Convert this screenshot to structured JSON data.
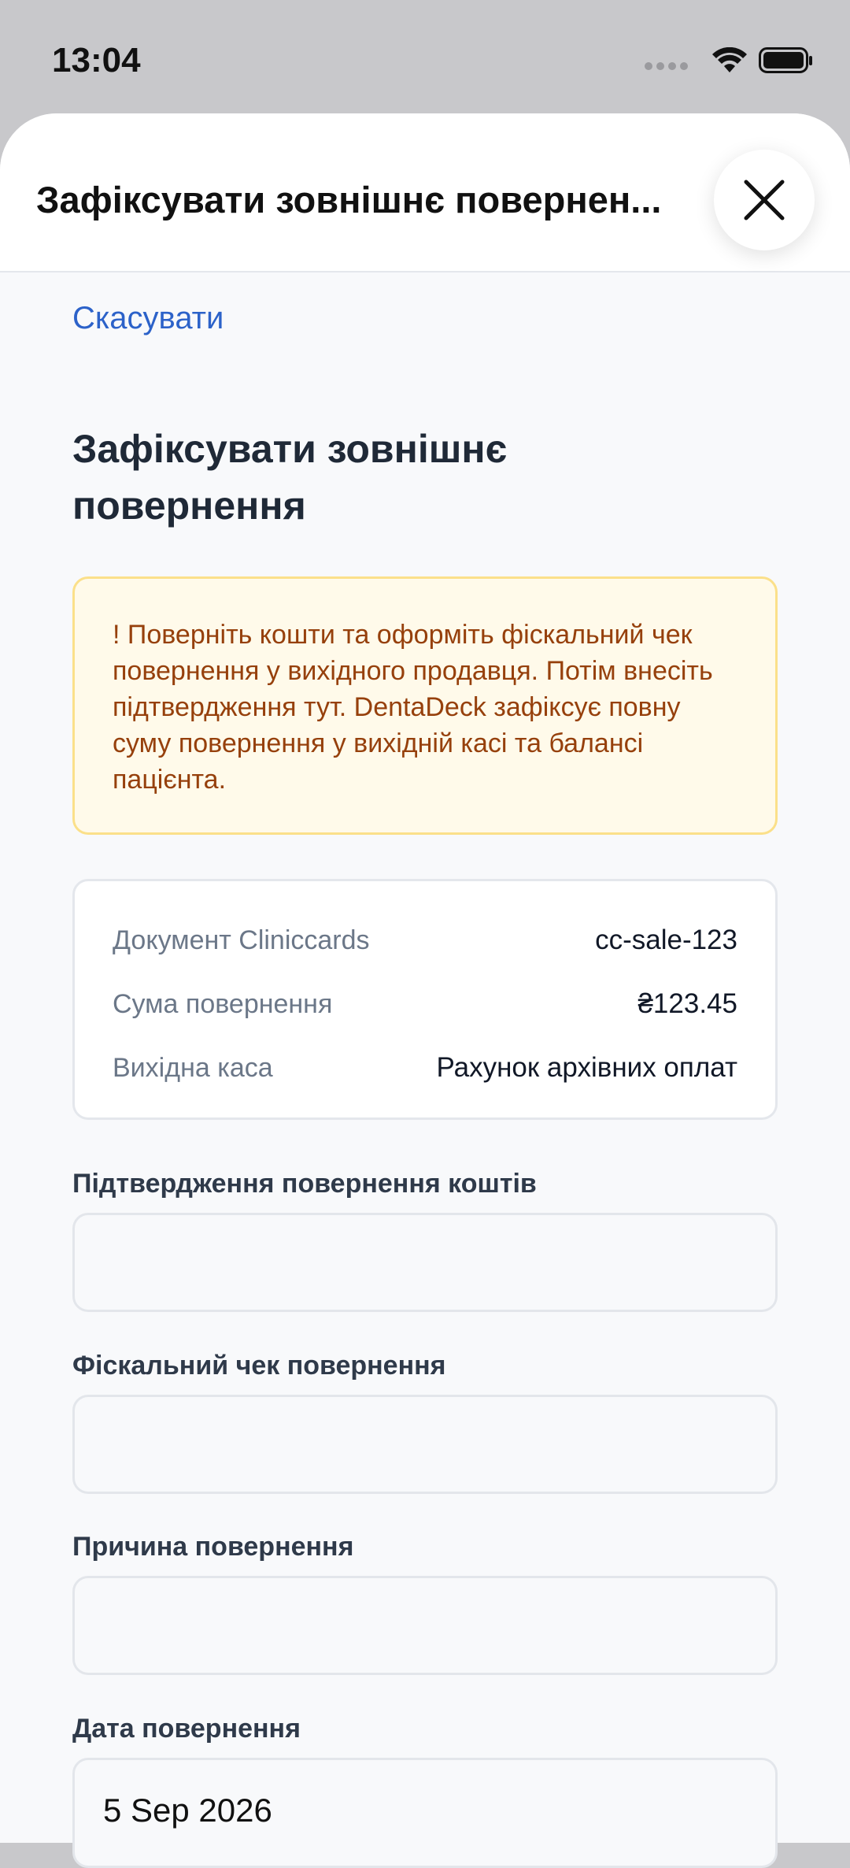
{
  "status_bar": {
    "time": "13:04"
  },
  "sheet": {
    "title": "Зафіксувати зовнішнє повернен..."
  },
  "cancel_label": "Скасувати",
  "page_title": "Зафіксувати зовнішнє повернення",
  "warning": {
    "text": "! Поверніть кошти та оформіть фіскальний чек повернення у вихідного продавця. Потім внесіть підтвердження тут. DentaDeck зафіксує повну суму повернення у вихідній касі та балансі пацієнта."
  },
  "info": {
    "rows": [
      {
        "label": "Документ Cliniccards",
        "value": "cc-sale-123"
      },
      {
        "label": "Сума повернення",
        "value": "₴123.45"
      },
      {
        "label": "Вихідна каса",
        "value": "Рахунок архівних оплат"
      }
    ]
  },
  "fields": {
    "confirmation": {
      "label": "Підтвердження повернення коштів",
      "value": ""
    },
    "fiscal_receipt": {
      "label": "Фіскальний чек повернення",
      "value": ""
    },
    "reason": {
      "label": "Причина повернення",
      "value": ""
    },
    "date": {
      "label": "Дата повернення",
      "value": "5 Sep 2026"
    }
  },
  "colors": {
    "accent": "#2c62c9",
    "warning_bg": "#fffaea",
    "warning_border": "#fbe08a",
    "warning_text": "#96400c"
  }
}
